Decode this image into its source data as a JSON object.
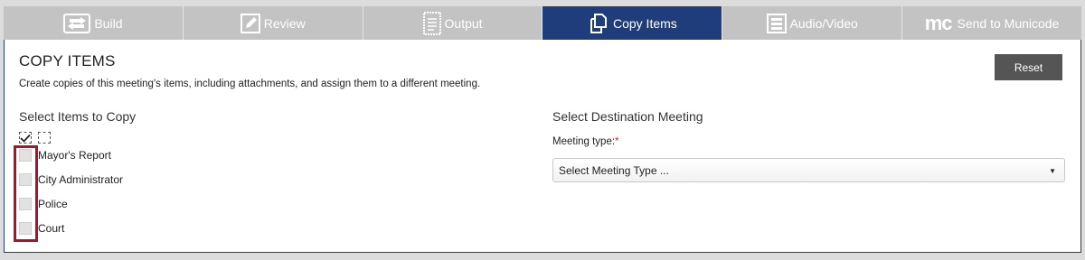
{
  "tabs": [
    {
      "label": "Build",
      "icon": "build-icon",
      "active": false
    },
    {
      "label": "Review",
      "icon": "pencil-icon",
      "active": false
    },
    {
      "label": "Output",
      "icon": "document-icon",
      "active": false
    },
    {
      "label": "Copy Items",
      "icon": "copy-icon",
      "active": true
    },
    {
      "label": "Audio/Video",
      "icon": "media-icon",
      "active": false
    },
    {
      "label": "Send to Municode",
      "icon": "municode-logo",
      "logo_text": "mc",
      "active": false
    }
  ],
  "page": {
    "title": "COPY ITEMS",
    "description": "Create copies of this meeting's items, including attachments, and assign them to a different meeting.",
    "reset_label": "Reset"
  },
  "left": {
    "heading": "Select Items to Copy",
    "items": [
      {
        "label": "Mayor's Report",
        "checked": false
      },
      {
        "label": "City Administrator",
        "checked": false
      },
      {
        "label": "Police",
        "checked": false
      },
      {
        "label": "Court",
        "checked": false
      }
    ]
  },
  "right": {
    "heading": "Select Destination Meeting",
    "meeting_type_label": "Meeting type:",
    "required_mark": "*",
    "meeting_type_value": "Select Meeting Type ..."
  },
  "colors": {
    "active_tab": "#1f3d7a",
    "inactive_tab": "#c3c3c3",
    "highlight_box": "#a8142a",
    "reset_button": "#555555"
  }
}
